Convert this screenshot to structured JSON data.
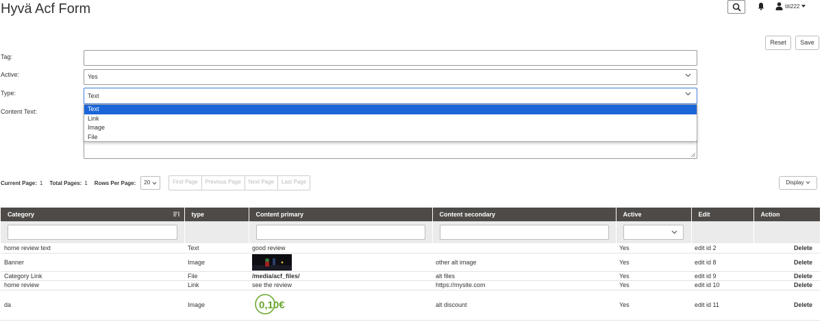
{
  "page": {
    "title": "Hyvä Acf Form"
  },
  "header": {
    "username": "titi222"
  },
  "form": {
    "reset_label": "Reset",
    "save_label": "Save",
    "tag_label": "Tag:",
    "tag_value": "",
    "active_label": "Active:",
    "active_value": "Yes",
    "type_label": "Type:",
    "type_value": "Text",
    "content_text_label": "Content Text:",
    "type_options": [
      "Text",
      "Link",
      "Image",
      "File"
    ]
  },
  "pager": {
    "current_page_label": "Current Page:",
    "current_page": "1",
    "total_pages_label": "Total Pages:",
    "total_pages": "1",
    "rows_per_page_label": "Rows Per Page:",
    "rows_per_page": "20",
    "first_page": "First Page",
    "previous_page": "Previous Page",
    "next_page": "Next Page",
    "last_page": "Last Page",
    "display_label": "Display"
  },
  "table": {
    "columns": [
      "Category",
      "type",
      "Content primary",
      "Content secondary",
      "Active",
      "Edit",
      "Action"
    ],
    "rows": [
      {
        "category": "home review text",
        "type": "Text",
        "primary": "good review",
        "secondary": "",
        "active": "Yes",
        "edit": "edit id 2",
        "action": "Delete"
      },
      {
        "category": "Banner",
        "type": "Image",
        "primary": "",
        "secondary": "other alt image",
        "active": "Yes",
        "edit": "edit id 8",
        "action": "Delete"
      },
      {
        "category": "Category Link",
        "type": "File",
        "primary": "/media/acf_files/",
        "secondary": "alt files",
        "active": "Yes",
        "edit": "edit id 9",
        "action": "Delete"
      },
      {
        "category": "home review",
        "type": "Link",
        "primary": "see the review",
        "secondary": "https://mysite.com",
        "active": "Yes",
        "edit": "edit id 10",
        "action": "Delete"
      },
      {
        "category": "da",
        "type": "Image",
        "primary": "",
        "secondary": "alt discount",
        "active": "Yes",
        "edit": "edit id 11",
        "action": "Delete"
      }
    ],
    "discount_image_text": "0,10€"
  },
  "icons": {
    "search": "search-icon",
    "bell": "bell-icon",
    "user": "user-icon",
    "caret": "caret-down-icon",
    "chevron": "chevron-down-icon",
    "sort": "sort-icon"
  },
  "colors": {
    "header_bg": "#4d4a47",
    "selected_option": "#1a66d9",
    "focus_border": "#3b7ad8",
    "discount_green": "#6aa82e"
  }
}
